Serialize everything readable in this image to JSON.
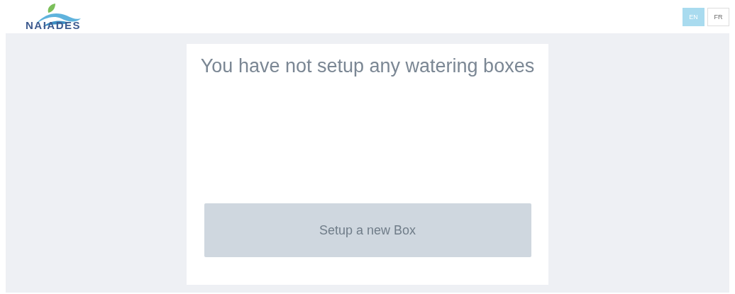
{
  "header": {
    "logo": "NAIADES",
    "languages": [
      {
        "label": "EN",
        "selected": true
      },
      {
        "label": "FR",
        "selected": false
      }
    ]
  },
  "card": {
    "message": "You have not setup any watering boxes",
    "button": "Setup a new Box"
  }
}
